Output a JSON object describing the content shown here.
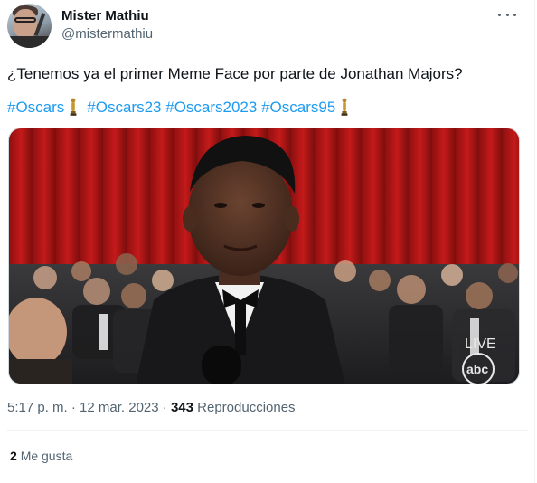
{
  "author": {
    "display_name": "Mister Mathiu",
    "handle": "@mistermathiu"
  },
  "tweet": {
    "text": "¿Tenemos ya el primer Meme Face por parte de Jonathan Majors?",
    "hashtags": [
      "#Oscars",
      "#Oscars23",
      "#Oscars2023",
      "#Oscars95"
    ],
    "hashtag_color": "#1d9bf0",
    "media": {
      "live_label": "LIVE",
      "broadcaster_logo": "abc"
    }
  },
  "meta": {
    "time": "5:17 p. m.",
    "separator": "·",
    "date": "12 mar. 2023",
    "separator2": "·",
    "views_count": "343",
    "views_label": "Reproducciones"
  },
  "engagement": {
    "likes_count": "2",
    "likes_label": "Me gusta"
  },
  "icons": [
    "more-options-icon",
    "oscar-trophy-icon"
  ]
}
